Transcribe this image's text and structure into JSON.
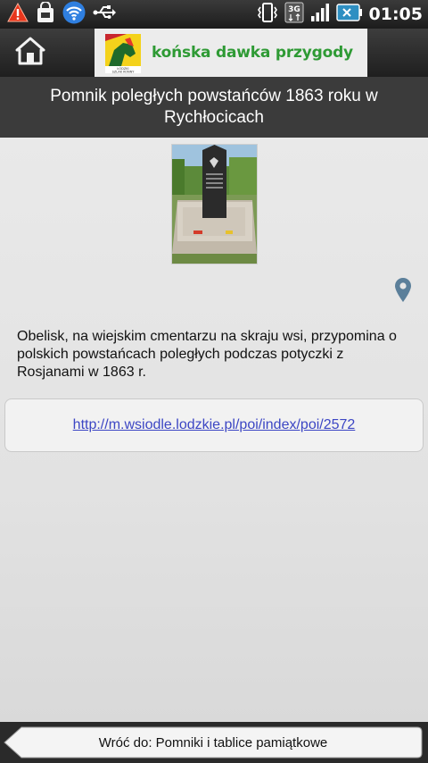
{
  "status_bar": {
    "time": "01:05",
    "icons": [
      "warning-icon",
      "shopping-bag-icon",
      "wifi-icon",
      "usb-icon",
      "vibrate-icon",
      "3g-icon",
      "signal-icon",
      "battery-icon"
    ]
  },
  "header": {
    "brand_text": "końska dawka przygody",
    "logo_caption": "ŁÓDZKI SZLAK KONNY",
    "home_icon": "home-icon"
  },
  "page": {
    "title": "Pomnik poległych powstańców 1863 roku w Rychłocicach",
    "description": "Obelisk, na wiejskim cmentarzu na skraju wsi, przypomina o polskich powstańcach poległych podczas potyczki z Rosjanami w 1863 r.",
    "link_url": "http://m.wsiodle.lodzkie.pl/poi/index/poi/2572"
  },
  "footer": {
    "back_label": "Wróć do: Pomniki i tablice pamiątkowe"
  },
  "colors": {
    "brand_green": "#2e9a34",
    "link": "#3c46c4",
    "pin": "#5b7f9a"
  }
}
